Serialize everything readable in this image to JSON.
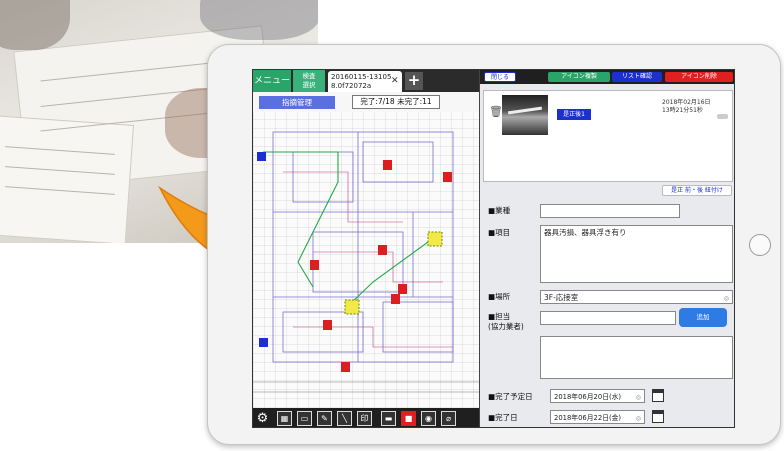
{
  "left_panel": {
    "menu_label": "メニュー",
    "select_label_line1": "検査",
    "select_label_line2": "選択",
    "file_tab_line1": "20160115-13105",
    "file_tab_line2": "8.0f72072a",
    "close_glyph": "✕",
    "add_glyph": "+",
    "management_button": "指摘管理",
    "status_text": "完了:7/18 未完了:11",
    "tools": [
      "⚙",
      "▦",
      "▭",
      "✎",
      "╲",
      "印",
      "▬",
      "■",
      "◉",
      "⌀"
    ]
  },
  "right_panel": {
    "buttons": {
      "close": "閉じる",
      "icon_copy": "アイコン複製",
      "list_confirm": "リスト確認",
      "icon_delete": "アイコン削除"
    },
    "photo_badge": "是正後1",
    "photo_date_line1": "2018年02月16日",
    "photo_date_line2": "13時21分51秒",
    "order_button": "是正 前・後 紐付け",
    "labels": {
      "trade": "■業種",
      "item": "■項目",
      "location": "■場所",
      "assignee_line1": "■担当",
      "assignee_line2": "(協力業者)",
      "due_date": "■完了予定日",
      "done_date": "■完了日"
    },
    "values": {
      "trade": "",
      "item": "器具汚損、器具浮き有り",
      "location": "3F-応接室",
      "assignee": "",
      "notes": "",
      "due_date": "2018年06月20日(水)",
      "done_date": "2018年06月22日(金)"
    },
    "add_button": "追加"
  },
  "colors": {
    "accent_green": "#2aa56a",
    "accent_blue": "#1c2fcf",
    "button_purple": "#5a6fe0",
    "delete_red": "#e02020",
    "arrow_orange": "#f39a1a"
  }
}
